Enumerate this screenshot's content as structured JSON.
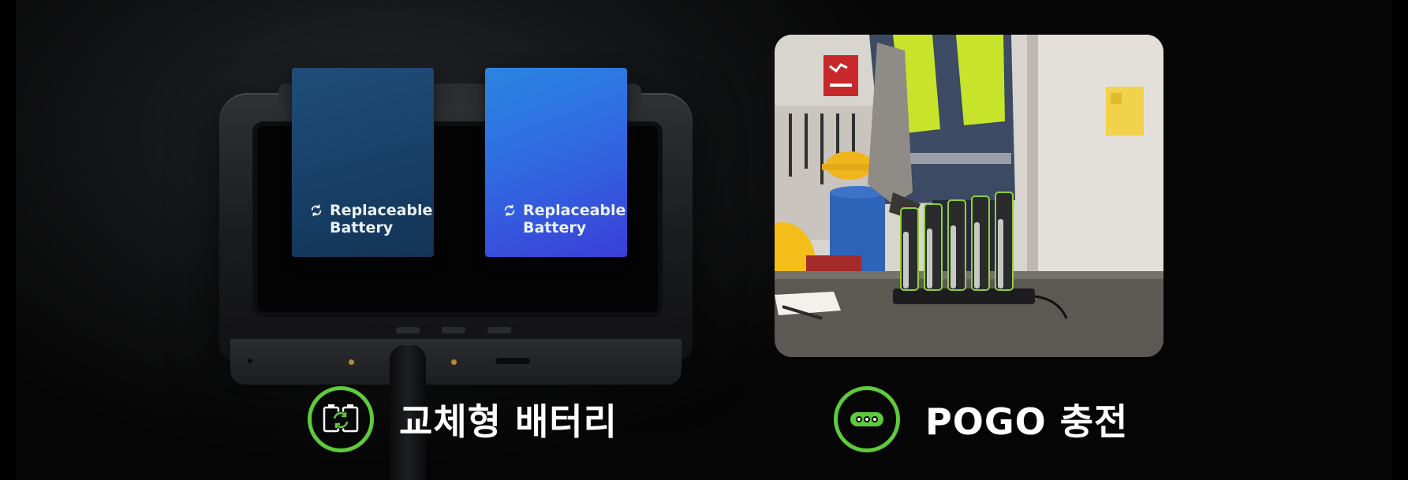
{
  "left_feature": {
    "battery_label_line1": "Replaceable",
    "battery_label_line2": "Battery",
    "caption": "교체형 배터리",
    "icon": "battery-swap-icon"
  },
  "right_feature": {
    "caption": "POGO 충전",
    "icon": "pogo-pins-icon"
  },
  "colors": {
    "accent_green": "#5ecb3a",
    "battery_dark": "#1f4d78",
    "battery_bright": "#2f6ee2",
    "background": "#000000"
  }
}
